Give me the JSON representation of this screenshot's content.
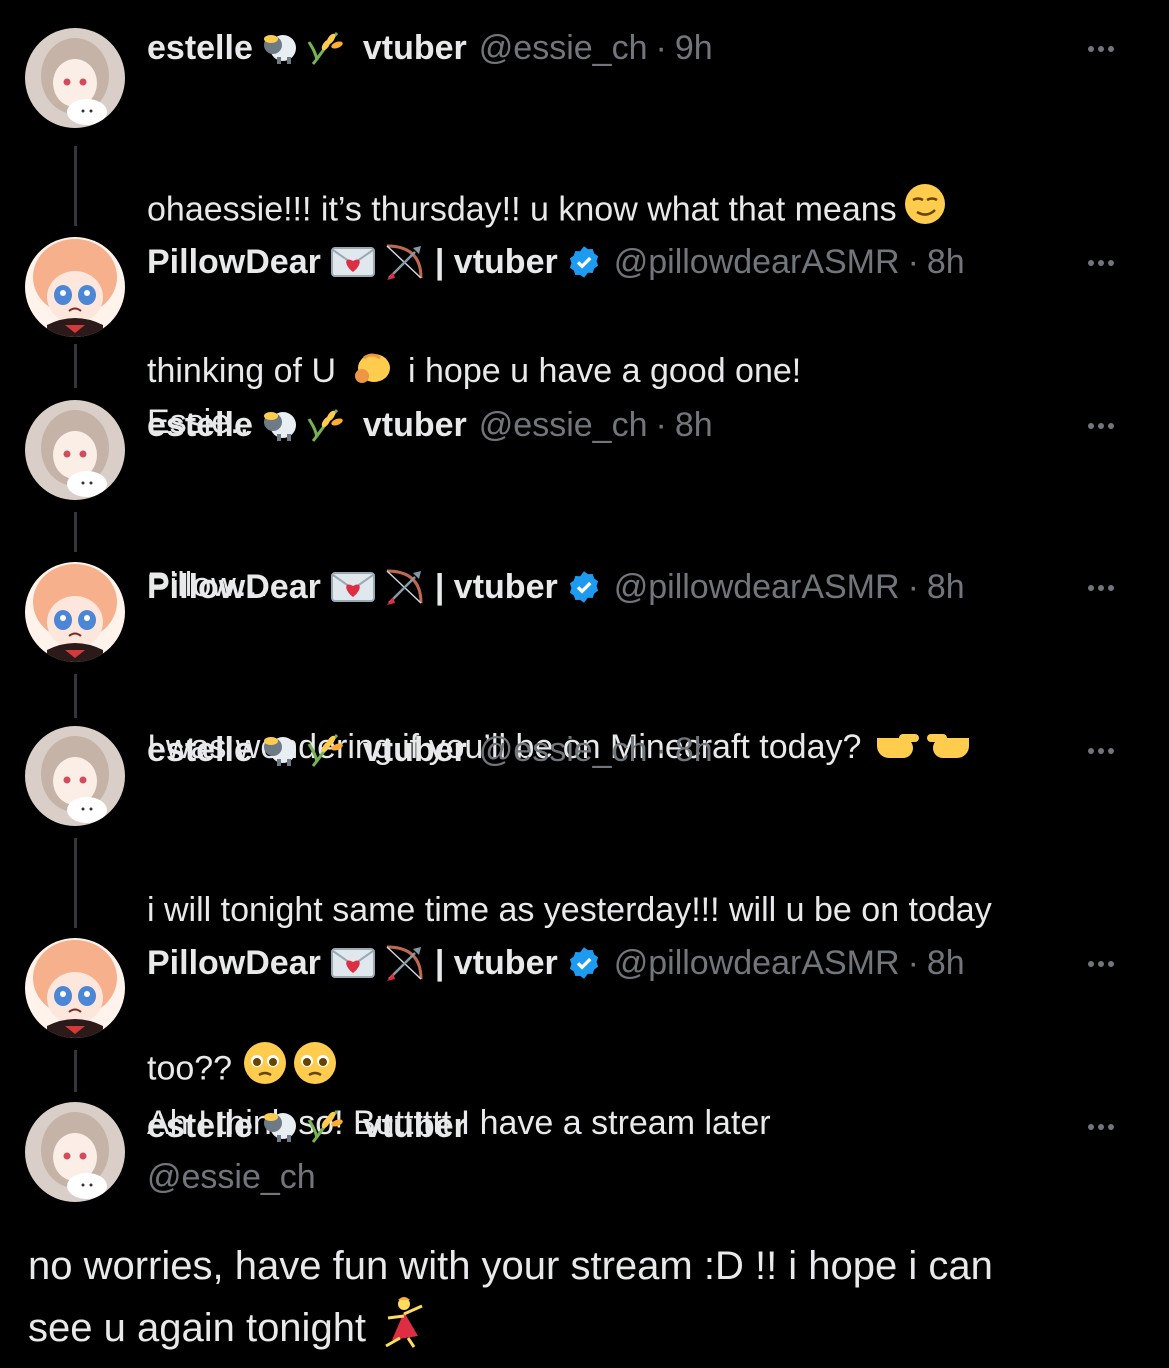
{
  "accounts": {
    "estelle": {
      "name": "estelle",
      "suffix": "vtuber",
      "handle": "@essie_ch"
    },
    "pillow": {
      "name": "PillowDear",
      "suffix": "| vtuber",
      "handle": "@pillowdearASMR"
    }
  },
  "separator": "·",
  "tweets": [
    {
      "time": "9h",
      "lines": [
        "ohaessie!!! it’s thursday!! u know what that means",
        "thinking of U",
        "i hope u have a good one!"
      ]
    },
    {
      "time": "8h",
      "lines": [
        "Essie.."
      ]
    },
    {
      "time": "8h",
      "lines": [
        "Pillow….."
      ]
    },
    {
      "time": "8h",
      "lines": [
        "I was wondering if you’ll be on Minecraft today?"
      ]
    },
    {
      "time": "8h",
      "lines": [
        "i will tonight same time as yesterday!!! will u be on today",
        "too??"
      ]
    },
    {
      "time": "8h",
      "lines": [
        "Ah I think so! Butttttt I have a stream later"
      ]
    }
  ],
  "main_tweet": {
    "line1": "no worries, have fun with your stream :D !! i hope i can",
    "line2": "see u again tonight"
  },
  "colors": {
    "background": "#000000",
    "text": "#e7e9ea",
    "muted": "#71767b",
    "thread_line": "#333639",
    "verified": "#1d9bf0"
  },
  "icons": [
    "sheep-icon",
    "rice-icon",
    "love-letter-icon",
    "bow-arrow-icon",
    "verified-badge-icon",
    "more-icon",
    "smirk-face-icon",
    "pointing-hand-icon",
    "pleading-face-icon",
    "dancer-icon"
  ]
}
